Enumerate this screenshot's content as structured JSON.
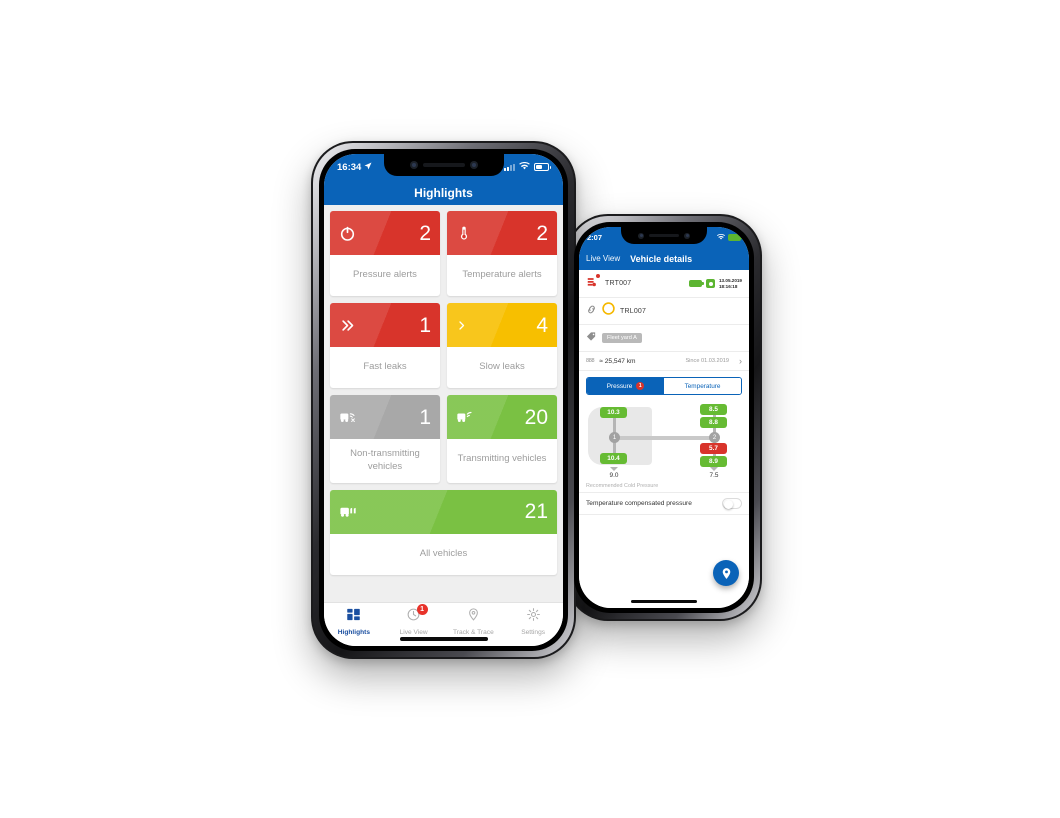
{
  "back_phone": {
    "status": {
      "time": "2:07"
    },
    "nav": {
      "back_label": "Live View",
      "title": "Vehicle details"
    },
    "vehicle": {
      "truck_id": "TRT007",
      "trailer_id": "TRL007",
      "tag": "Fleet yard A",
      "timestamp_date": "13.05.2019",
      "timestamp_time": "18:16:18",
      "odometer": "≈ 25,547 km",
      "since": "Since 01.03.2019",
      "chevron": "›"
    },
    "segment": {
      "pressure_label": "Pressure",
      "pressure_badge": "1",
      "temperature_label": "Temperature"
    },
    "diagram": {
      "axle1_label": "1",
      "axle2_label": "2",
      "axle1_top": "10.3",
      "axle1_bottom": "10.4",
      "axle1_recommended": "9.0",
      "axle2_t1": "8.5",
      "axle2_t2": "8.8",
      "axle2_t3": "5.7",
      "axle2_t4": "8.9",
      "axle2_recommended": "7.5"
    },
    "recommended_label": "Recommended Cold Pressure",
    "toggle": {
      "label": "Temperature compensated pressure",
      "state": "off"
    },
    "fab": {
      "icon": "location-pin-icon"
    }
  },
  "front_phone": {
    "status": {
      "time": "16:34",
      "location_icon": "location-arrow-icon",
      "signal_icon": "signal-bars-icon",
      "wifi_icon": "wifi-icon",
      "battery_icon": "battery-icon"
    },
    "nav": {
      "title": "Highlights"
    },
    "cards": [
      {
        "icon": "tyre-pressure-icon",
        "value": "2",
        "label": "Pressure alerts",
        "color": "#d8342b",
        "style": "bg-red"
      },
      {
        "icon": "thermometer-icon",
        "value": "2",
        "label": "Temperature alerts",
        "color": "#d8342b",
        "style": "bg-red"
      },
      {
        "icon": "double-chevron-icon",
        "value": "1",
        "label": "Fast leaks",
        "color": "#d8342b",
        "style": "bg-red"
      },
      {
        "icon": "single-chevron-icon",
        "value": "4",
        "label": "Slow leaks",
        "color": "#f7bf00",
        "style": "bg-yellow"
      },
      {
        "icon": "vehicle-no-signal-icon",
        "value": "1",
        "label": "Non-transmitting vehicles",
        "color": "#a8a8a8",
        "style": "bg-gray"
      },
      {
        "icon": "vehicle-signal-icon",
        "value": "20",
        "label": "Transmitting vehicles",
        "color": "#7ac143",
        "style": "bg-green"
      }
    ],
    "wide_card": {
      "icon": "multiple-vehicles-icon",
      "value": "21",
      "label": "All vehicles",
      "color": "#7ac143",
      "style": "bg-green"
    },
    "tabs": [
      {
        "icon": "grid-icon",
        "label": "Highlights",
        "active": true,
        "badge": ""
      },
      {
        "icon": "gauge-icon",
        "label": "Live View",
        "active": false,
        "badge": "1"
      },
      {
        "icon": "map-pin-icon",
        "label": "Track & Trace",
        "active": false,
        "badge": ""
      },
      {
        "icon": "gear-icon",
        "label": "Settings",
        "active": false,
        "badge": ""
      }
    ]
  }
}
